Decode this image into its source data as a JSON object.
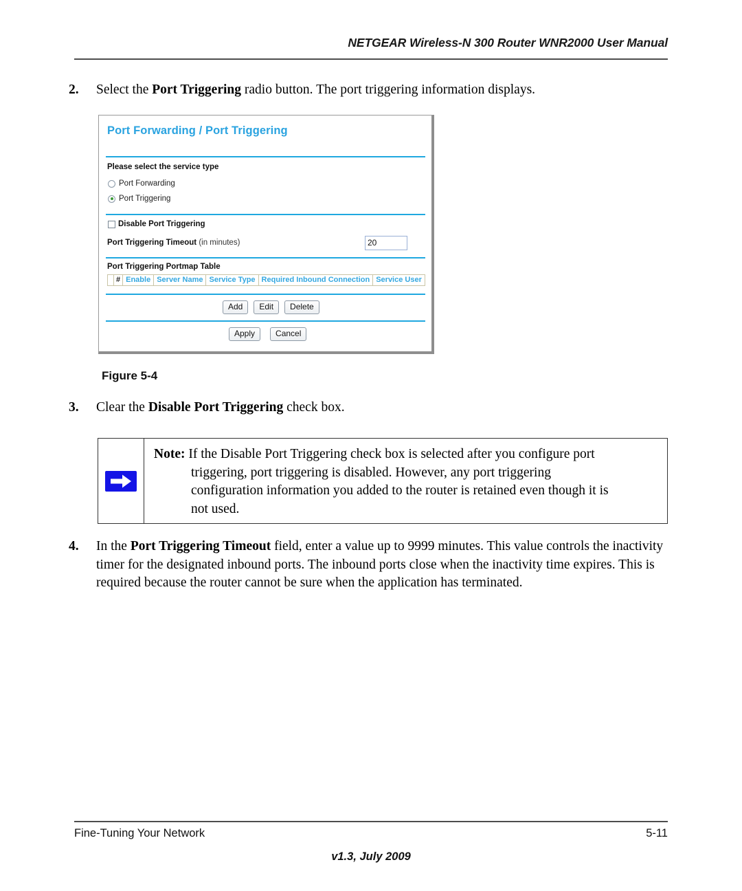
{
  "header": {
    "running_head": "NETGEAR Wireless-N 300 Router WNR2000 User Manual"
  },
  "steps": {
    "step2": {
      "number": "2.",
      "text_before": "Select the ",
      "bold": "Port Triggering",
      "text_after": " radio button. The port triggering information displays."
    },
    "step3": {
      "number": "3.",
      "text_before": "Clear the ",
      "bold": "Disable Port Triggering",
      "text_after": " check box."
    },
    "step4": {
      "number": "4.",
      "text_before": "In the ",
      "bold": "Port Triggering Timeout",
      "text_after": " field, enter a value up to 9999 minutes. This value controls the inactivity timer for the designated inbound ports. The inbound ports close when the inactivity time expires. This is required because the router cannot be sure when the application has terminated."
    }
  },
  "figure": {
    "caption": "Figure 5-4",
    "screenshot": {
      "title": "Port Forwarding / Port Triggering",
      "service_type_label": "Please select the service type",
      "radios": [
        {
          "label": "Port Forwarding",
          "selected": false
        },
        {
          "label": "Port Triggering",
          "selected": true
        }
      ],
      "disable_checkbox": {
        "label": "Disable Port Triggering",
        "checked": false
      },
      "timeout": {
        "label_bold": "Port Triggering Timeout",
        "label_normal": " (in minutes)",
        "value": "20"
      },
      "portmap": {
        "title": "Port Triggering Portmap Table",
        "columns": [
          "#",
          "Enable",
          "Server Name",
          "Service Type",
          "Required Inbound Connection",
          "Service User"
        ]
      },
      "row_buttons": [
        "Add",
        "Edit",
        "Delete"
      ],
      "form_buttons": [
        "Apply",
        "Cancel"
      ],
      "accent_color": "#2aa3e0",
      "header_text_color": "#35a8e0"
    }
  },
  "note": {
    "label": "Note:",
    "line1": " If the Disable Port Triggering check box is selected after you configure port",
    "line2": "triggering, port triggering is disabled. However, any port triggering",
    "line3": "configuration information you added to the router is retained even though it is",
    "line4": "not used.",
    "icon_color": "#1414e6"
  },
  "footer": {
    "left": "Fine-Tuning Your Network",
    "right": "5-11",
    "center": "v1.3, July 2009"
  }
}
